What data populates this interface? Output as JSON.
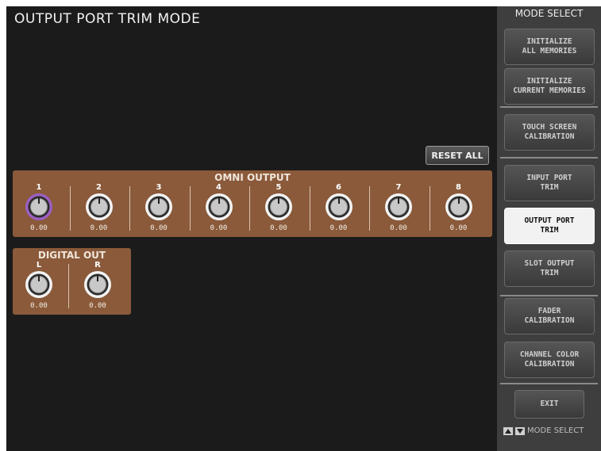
{
  "title": "OUTPUT PORT TRIM MODE",
  "reset_all": "RESET ALL",
  "omni": {
    "title": "OMNI OUTPUT",
    "channels": [
      {
        "label": "1",
        "value": "0.00",
        "selected": true
      },
      {
        "label": "2",
        "value": "0.00"
      },
      {
        "label": "3",
        "value": "0.00"
      },
      {
        "label": "4",
        "value": "0.00"
      },
      {
        "label": "5",
        "value": "0.00"
      },
      {
        "label": "6",
        "value": "0.00"
      },
      {
        "label": "7",
        "value": "0.00"
      },
      {
        "label": "8",
        "value": "0.00"
      }
    ]
  },
  "digital": {
    "title": "DIGITAL OUT",
    "channels": [
      {
        "label": "L",
        "value": "0.00"
      },
      {
        "label": "R",
        "value": "0.00"
      }
    ]
  },
  "sidebar": {
    "title": "MODE SELECT",
    "buttons": [
      {
        "label": "INITIALIZE\nALL MEMORIES"
      },
      {
        "label": "INITIALIZE\nCURRENT MEMORIES"
      },
      {
        "label": "TOUCH SCREEN\nCALIBRATION"
      },
      {
        "label": "INPUT PORT\nTRIM"
      },
      {
        "label": "OUTPUT PORT\nTRIM",
        "active": true
      },
      {
        "label": "SLOT OUTPUT\nTRIM"
      },
      {
        "label": "FADER\nCALIBRATION"
      },
      {
        "label": "CHANNEL COLOR\nCALIBRATION"
      },
      {
        "label": "EXIT"
      }
    ],
    "footer": "MODE SELECT"
  },
  "colors": {
    "panel": "#8a5a3a",
    "selected_ring": "#9b5fc0",
    "background": "#1b1b1b"
  }
}
